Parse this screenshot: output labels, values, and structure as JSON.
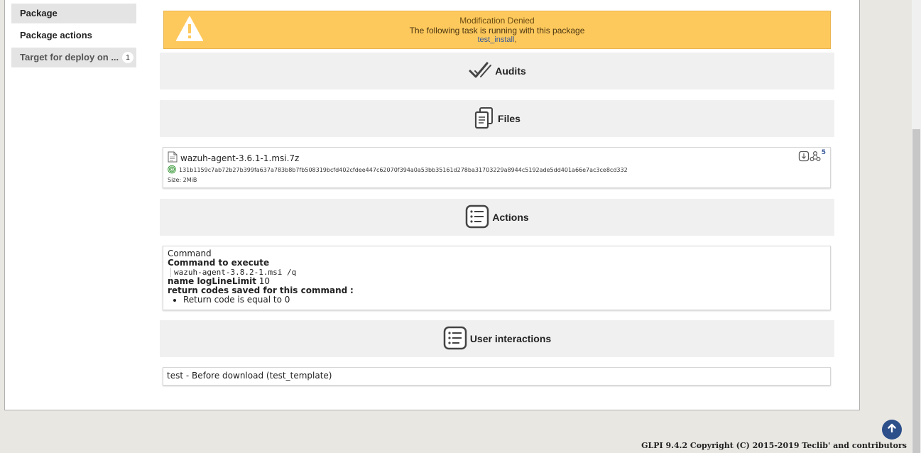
{
  "sidebar": {
    "tabs": [
      {
        "label": "Package"
      },
      {
        "label": "Package actions"
      },
      {
        "label": "Target for deploy on ...",
        "badge": "1"
      }
    ]
  },
  "warning": {
    "title": "Modification Denied",
    "message": "The following task is running with this package",
    "task_link": "test_install",
    "task_suffix": ","
  },
  "sections": {
    "audits": "Audits",
    "files": "Files",
    "actions": "Actions",
    "user_interactions": "User interactions"
  },
  "file": {
    "name": "wazuh-agent-3.6.1-1.msi.7z",
    "hash": "131b1159c7ab72b27b399fa637a783b8b7fb508319bcfd402cfdee447c62070f394a0a53bb35161d278ba31703229a8944c5192ade5dd401a66e7ac3ce8cd332",
    "size": "Size: 2MiB",
    "mirror_count": "5"
  },
  "action": {
    "type": "Command",
    "command_label": "Command to execute",
    "command_value": "wazuh-agent-3.8.2-1.msi /q",
    "log_label": "name logLineLimit",
    "log_value": "10",
    "return_codes_label": "return codes saved for this command",
    "return_codes_colon": ":",
    "return_codes": [
      "Return code is equal to 0"
    ]
  },
  "user_interaction": {
    "text": "test - Before download (test_template)"
  },
  "footer": {
    "copyright": "GLPI 9.4.2 Copyright (C) 2015-2019 Teclib' and contributors"
  },
  "colors": {
    "warning_bg": "#fec95c",
    "section_bg": "#f0f0f0",
    "link": "#3a5a9a",
    "scroll_top_button": "#2d4f8a"
  }
}
